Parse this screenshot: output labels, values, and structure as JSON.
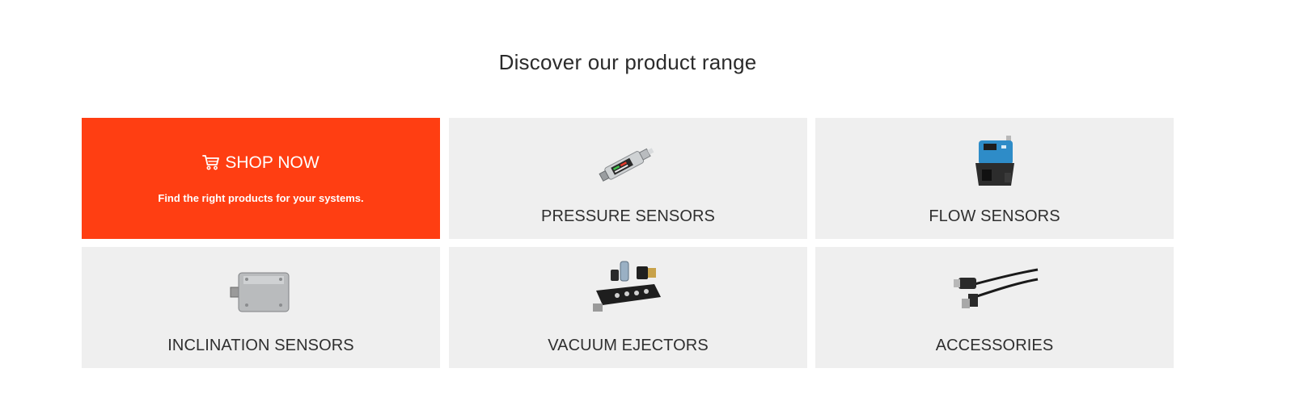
{
  "section": {
    "title": "Discover our product range"
  },
  "shop": {
    "label": "SHOP NOW",
    "subtitle": "Find the right products for your systems.",
    "icon": "cart-icon",
    "color": "#ff3e12"
  },
  "categories": [
    {
      "label": "PRESSURE SENSORS",
      "icon": "pressure-sensor-image"
    },
    {
      "label": "FLOW SENSORS",
      "icon": "flow-sensor-image"
    },
    {
      "label": "INCLINATION SENSORS",
      "icon": "inclination-sensor-image"
    },
    {
      "label": "VACUUM EJECTORS",
      "icon": "vacuum-ejector-image"
    },
    {
      "label": "ACCESSORIES",
      "icon": "accessories-cable-image"
    }
  ]
}
